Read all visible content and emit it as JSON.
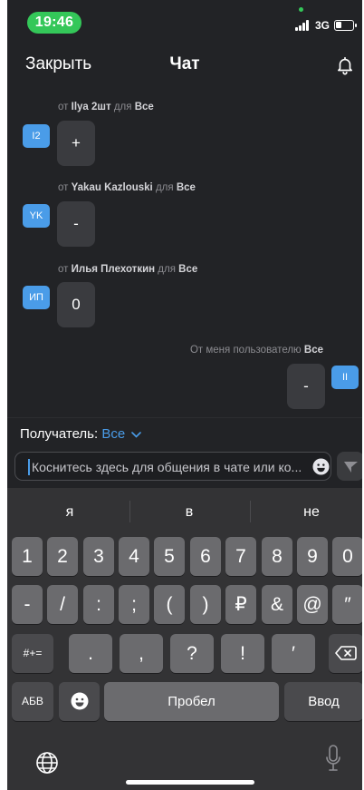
{
  "status_bar": {
    "time": "19:46",
    "network": "3G"
  },
  "header": {
    "close_label": "Закрыть",
    "title": "Чат"
  },
  "messages": [
    {
      "from_prefix": "от",
      "sender": "Ilya 2шт",
      "to_prefix": "для",
      "recipient": "Все",
      "avatar": "I2",
      "text": "+"
    },
    {
      "from_prefix": "от",
      "sender": "Yakau Kazlouski",
      "to_prefix": "для",
      "recipient": "Все",
      "avatar": "YK",
      "text": "-"
    },
    {
      "from_prefix": "от",
      "sender": "Илья Плехоткин",
      "to_prefix": "для",
      "recipient": "Все",
      "avatar": "ИП",
      "text": "0"
    }
  ],
  "own_message": {
    "meta_prefix": "От меня пользователю",
    "recipient": "Все",
    "avatar": "II",
    "text": "-"
  },
  "composer": {
    "recipient_label": "Получатель:",
    "recipient_value": "Все",
    "placeholder": "Коснитесь здесь для общения в чате или ко..."
  },
  "keyboard": {
    "suggestions": [
      "я",
      "в",
      "не"
    ],
    "row1": [
      "1",
      "2",
      "3",
      "4",
      "5",
      "6",
      "7",
      "8",
      "9",
      "0"
    ],
    "row2": [
      "-",
      "/",
      ":",
      ";",
      "(",
      ")",
      "₽",
      "&",
      "@",
      "″"
    ],
    "row3": {
      "shift": "#+=",
      "keys": [
        ".",
        ",",
        "?",
        "!",
        "′"
      ]
    },
    "row4": {
      "abc": "АБВ",
      "space": "Пробел",
      "enter": "Ввод"
    }
  },
  "icons": [
    "bell-icon",
    "chevron-down-icon",
    "emoji-icon",
    "send-icon",
    "backspace-icon",
    "globe-icon",
    "microphone-icon"
  ],
  "colors": {
    "background": "#222326",
    "accent": "#4a9ce8",
    "time_pill": "#34c759",
    "keyboard": "#333335",
    "key": "#6b6b6e"
  }
}
